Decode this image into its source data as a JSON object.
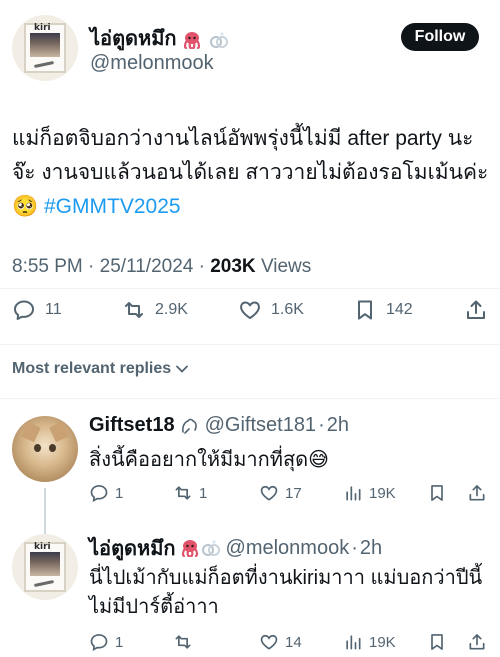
{
  "main_tweet": {
    "author_name": "ไอ่ตูดหมึก",
    "author_handle": "@melonmook",
    "follow_label": "Follow",
    "avatar_logo": "kiri",
    "text": "แม่ก็อตจิบอกว่างานไลน์อัพพรุ่งนี้ไม่มี after party นะจ๊ะ งานจบแล้วนอนได้เลย สาววายไม่ต้องรอโมเม้นค่ะ 🥺",
    "hashtag": "#GMMTV2025",
    "time": "8:55 PM",
    "date": "25/11/2024",
    "views_count": "203K",
    "views_label": "Views",
    "stats": {
      "replies": "11",
      "reposts": "2.9K",
      "likes": "1.6K",
      "bookmarks": "142"
    }
  },
  "replies_filter_label": "Most relevant replies",
  "replies": [
    {
      "author_name": "Giftset18",
      "author_handle": "@Giftset181",
      "time_ago": "2h",
      "text": "สิ่งนี้คืออยากให้มีมากที่สุด😅",
      "stats": {
        "replies": "1",
        "reposts": "1",
        "likes": "17",
        "views": "19K"
      }
    },
    {
      "author_name": "ไอ่ตูดหมึก",
      "author_handle": "@melonmook",
      "time_ago": "2h",
      "text": "นี่ไปเม้ากับแม่ก็อตที่งานkiriมาาา แม่บอกว่าปีนี้ไม่มีปาร์ตี้อ่าาา",
      "stats": {
        "replies": "1",
        "reposts": "",
        "likes": "14",
        "views": "19K"
      }
    }
  ],
  "colors": {
    "text": "#0f1419",
    "secondary": "#536471",
    "link": "#1d9bf0",
    "follow_bg": "#0f1419",
    "divider": "#eff3f4"
  }
}
